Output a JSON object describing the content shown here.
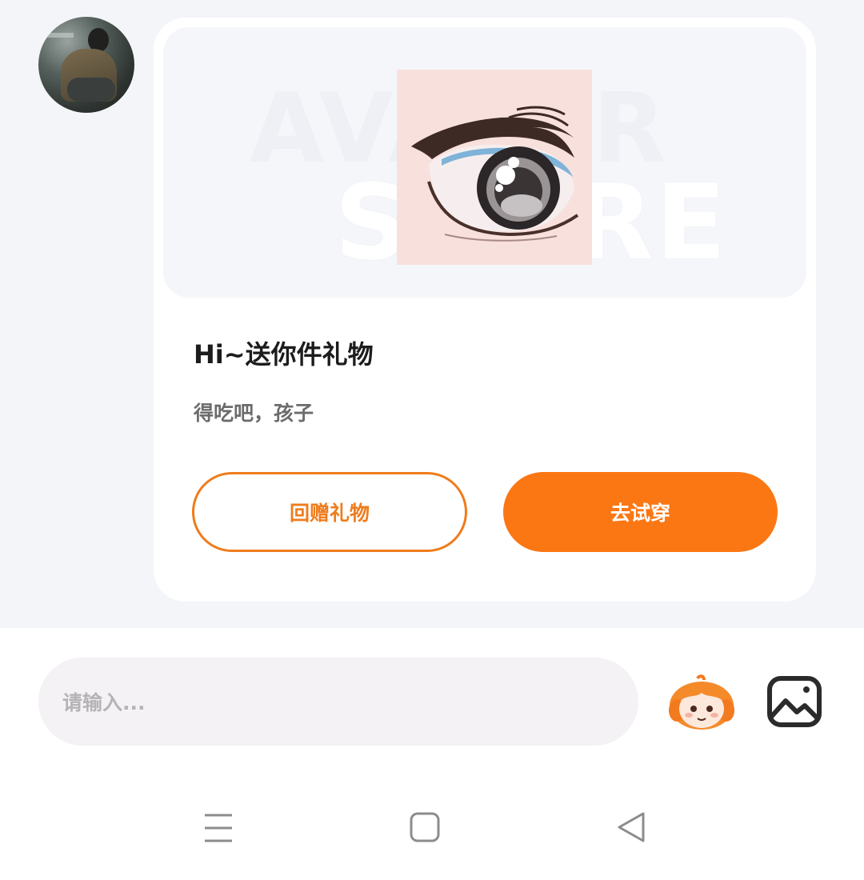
{
  "message_card": {
    "banner_watermark_line1": "AVATAR",
    "banner_watermark_line2": "STORE",
    "title": "Hi~送你件礼物",
    "subtitle": "得吃吧，孩子",
    "return_gift_label": "回赠礼物",
    "try_on_label": "去试穿"
  },
  "composer": {
    "placeholder": "请输入..."
  },
  "icons": {
    "avatar": "user-avatar-photo",
    "gift_thumbnail": "anime-eye-item",
    "mascot": "mascot-sticker-icon",
    "image": "image-picker-icon",
    "nav_menu": "menu-icon",
    "nav_home": "home-icon",
    "nav_back": "back-icon"
  },
  "colors": {
    "accent": "#fb7714",
    "chat_background": "#f4f5f9",
    "card": "#ffffff",
    "input_background": "#f4f2f4"
  }
}
